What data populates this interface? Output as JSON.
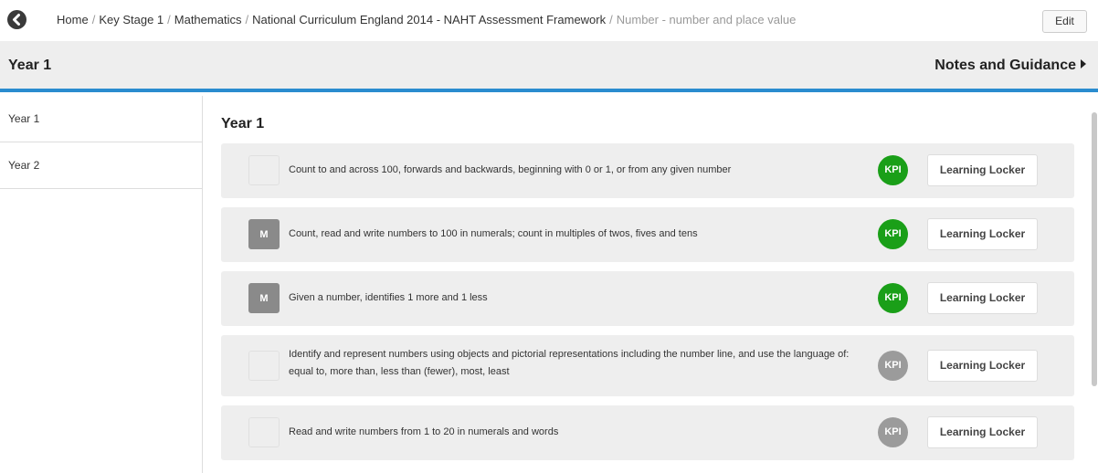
{
  "nav": {
    "back_icon": "chevron-left-circle-icon",
    "breadcrumb": [
      "Home",
      "Key Stage 1",
      "Mathematics",
      "National Curriculum England 2014 - NAHT Assessment Framework"
    ],
    "separator": "/",
    "current": "Number - number and place value",
    "edit_label": "Edit"
  },
  "header": {
    "title": "Year 1",
    "notes_label": "Notes and Guidance"
  },
  "sidebar": {
    "items": [
      {
        "label": "Year 1"
      },
      {
        "label": "Year 2"
      }
    ]
  },
  "main": {
    "section_title": "Year 1",
    "objectives": [
      {
        "mark": "",
        "text": "Count to and across 100, forwards and backwards, beginning with 0 or 1, or from any given number",
        "kpi": "KPI",
        "kpi_active": true,
        "button": "Learning Locker"
      },
      {
        "mark": "M",
        "text": "Count, read and write numbers to 100 in numerals; count in multiples of twos, fives and tens",
        "kpi": "KPI",
        "kpi_active": true,
        "button": "Learning Locker"
      },
      {
        "mark": "M",
        "text": "Given a number, identifies 1 more and 1 less",
        "kpi": "KPI",
        "kpi_active": true,
        "button": "Learning Locker"
      },
      {
        "mark": "",
        "text": "Identify and represent numbers using objects and pictorial representations including the number line, and use the language of: equal to, more than, less than (fewer), most, least",
        "kpi": "KPI",
        "kpi_active": false,
        "button": "Learning Locker"
      },
      {
        "mark": "",
        "text": "Read and write numbers from 1 to 20 in numerals and words",
        "kpi": "KPI",
        "kpi_active": false,
        "button": "Learning Locker"
      }
    ]
  },
  "colors": {
    "accent": "#2a8ccf",
    "kpi_active": "#1a9f18",
    "kpi_inactive": "#9b9b9b",
    "mark": "#8a8a8a"
  }
}
